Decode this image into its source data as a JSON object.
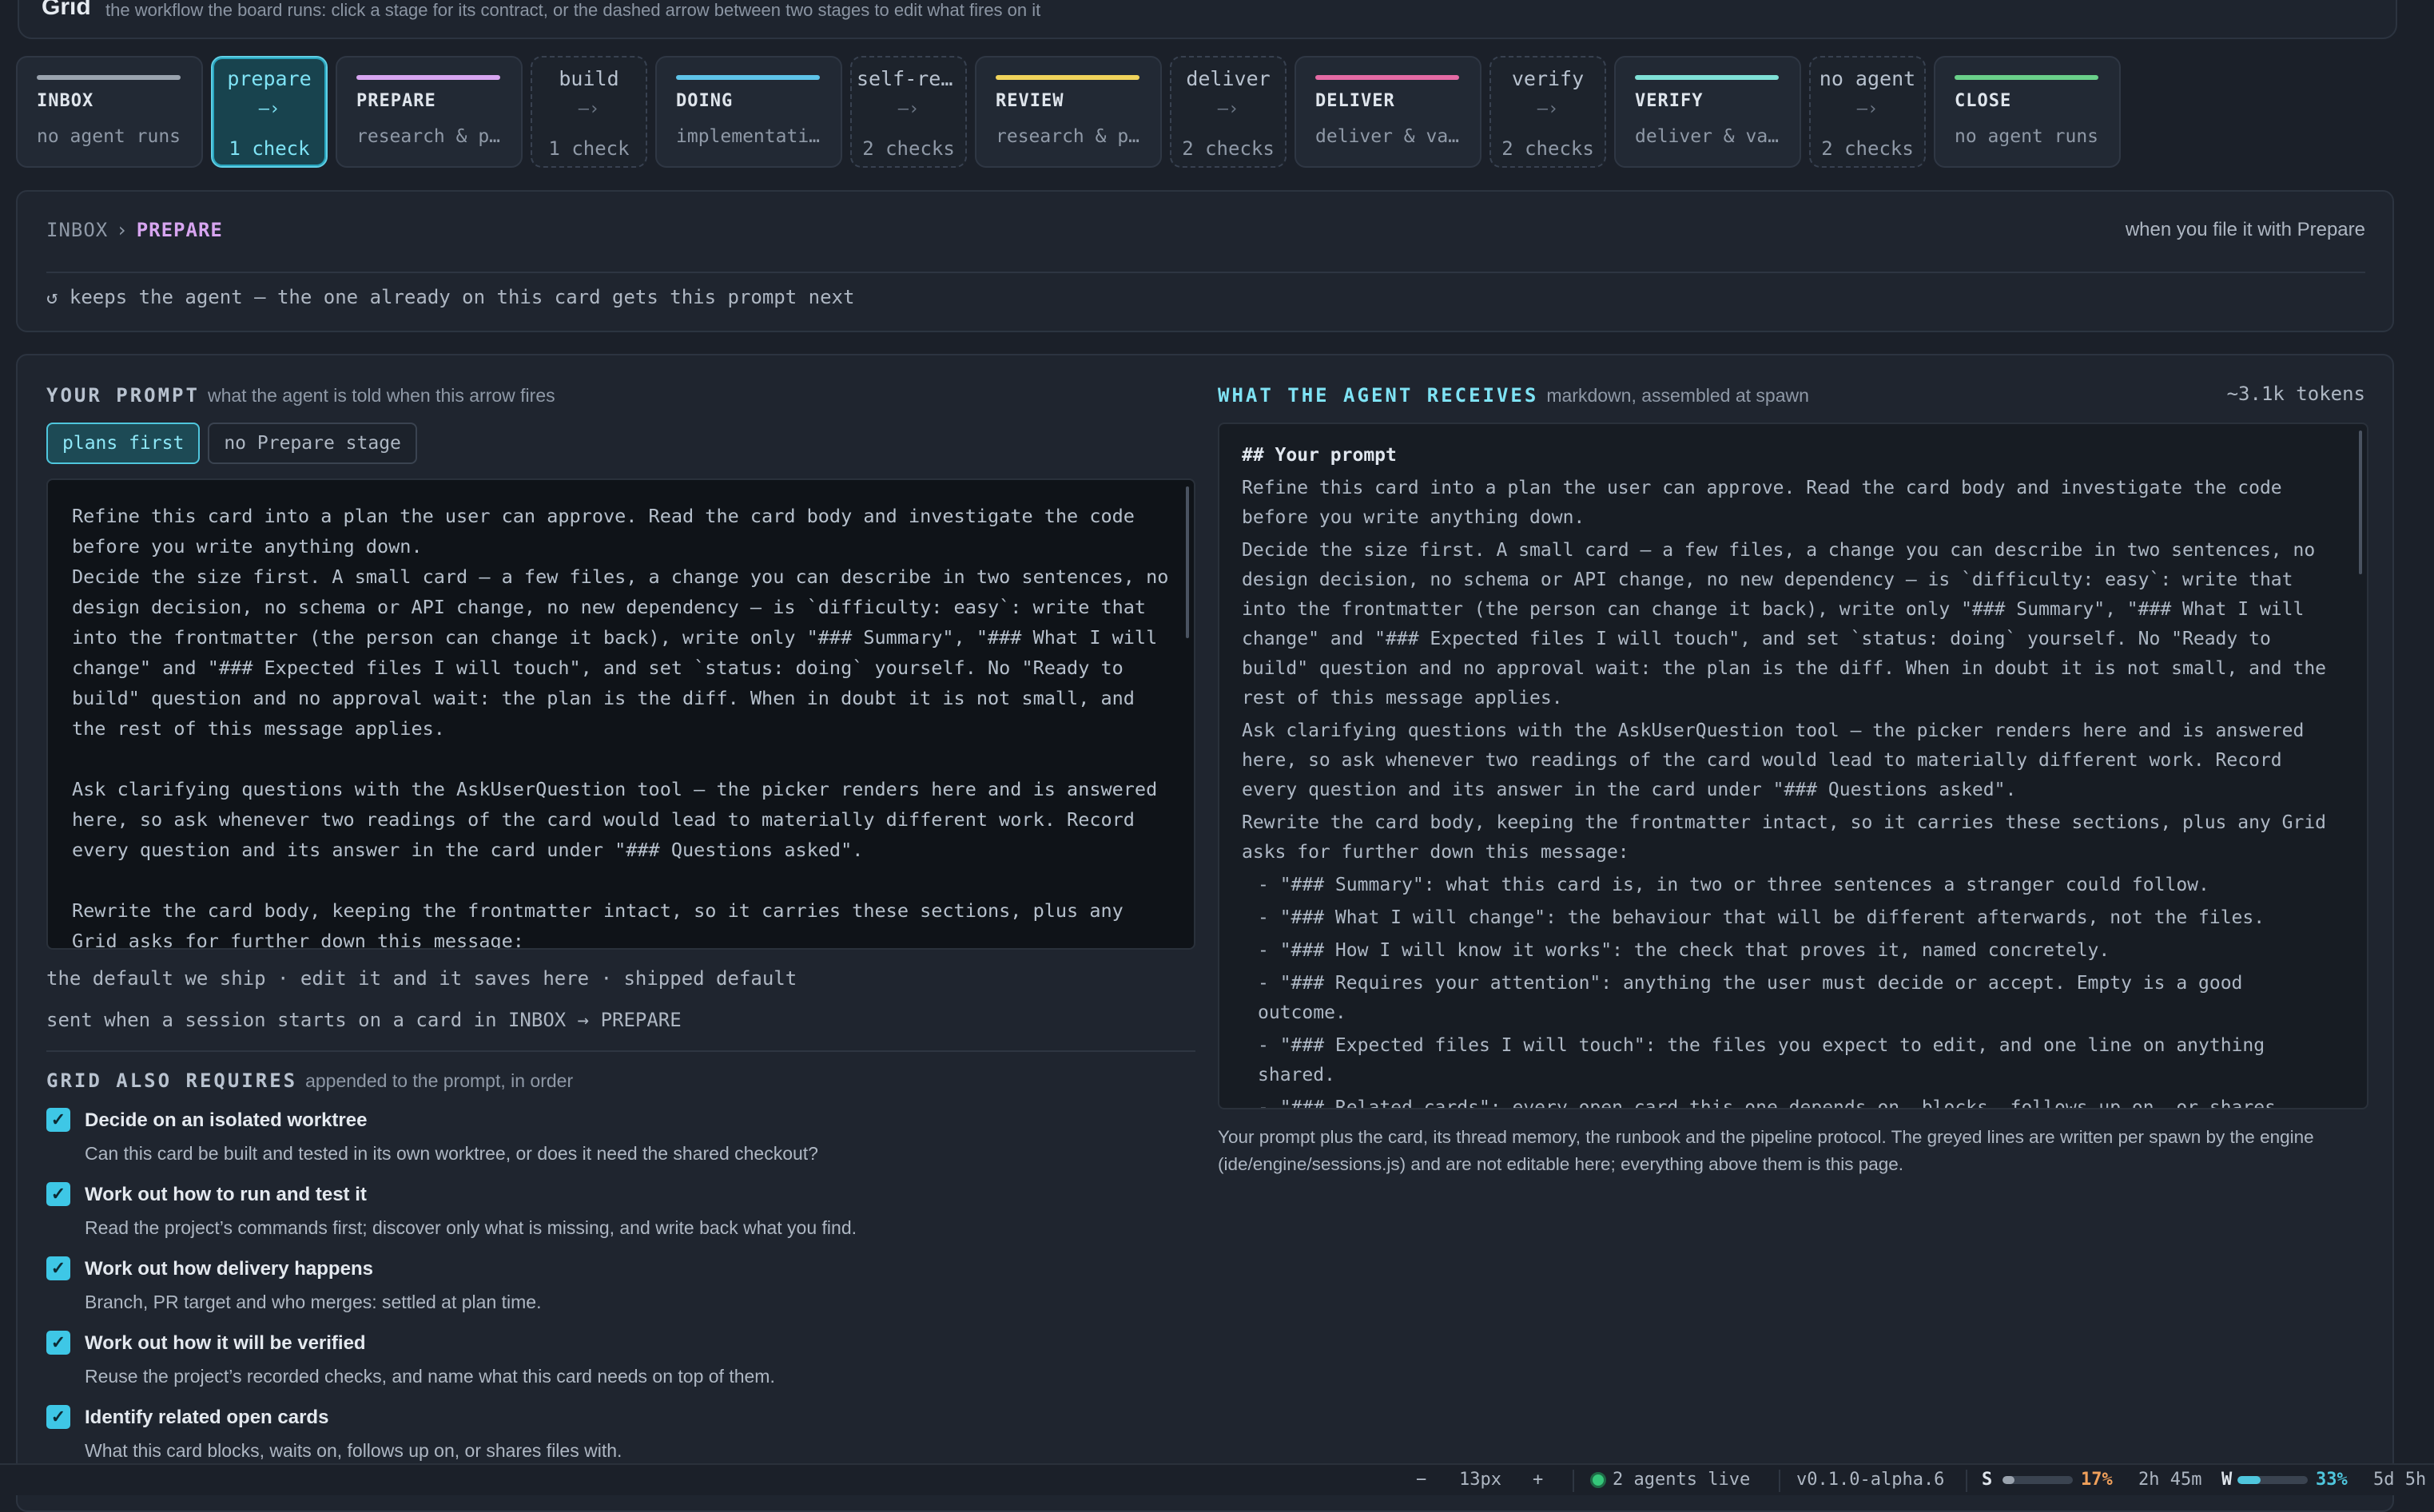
{
  "header": {
    "title": "Grid",
    "subtitle": "the workflow the board runs: click a stage for its contract, or the dashed arrow between two stages to edit what fires on it"
  },
  "pipeline": [
    {
      "kind": "stage",
      "name": "INBOX",
      "desc": "no agent runs",
      "color": "#9aa3ae"
    },
    {
      "kind": "arrow",
      "label": "prepare",
      "mid": "—›",
      "checks": "1 check",
      "selected": true
    },
    {
      "kind": "stage",
      "name": "PREPARE",
      "desc": "research & plan",
      "color": "#d7a5f0"
    },
    {
      "kind": "arrow",
      "label": "build",
      "mid": "—›",
      "checks": "1 check",
      "selected": false
    },
    {
      "kind": "stage",
      "name": "DOING",
      "desc": "implementation",
      "color": "#5ec3e8"
    },
    {
      "kind": "arrow",
      "label": "self-review",
      "mid": "—›",
      "checks": "2 checks",
      "selected": false
    },
    {
      "kind": "stage",
      "name": "REVIEW",
      "desc": "research & plan",
      "color": "#f0d35b"
    },
    {
      "kind": "arrow",
      "label": "deliver",
      "mid": "—›",
      "checks": "2 checks",
      "selected": false
    },
    {
      "kind": "stage",
      "name": "DELIVER",
      "desc": "deliver & validate",
      "color": "#e46aa4"
    },
    {
      "kind": "arrow",
      "label": "verify",
      "mid": "—›",
      "checks": "2 checks",
      "selected": false
    },
    {
      "kind": "stage",
      "name": "VERIFY",
      "desc": "deliver & validate",
      "color": "#7fe0d6"
    },
    {
      "kind": "arrow",
      "label": "no agent",
      "mid": "—›",
      "checks": "2 checks",
      "selected": false
    },
    {
      "kind": "stage",
      "name": "CLOSE",
      "desc": "no agent runs",
      "color": "#6ad08a"
    }
  ],
  "transition": {
    "from": "INBOX",
    "separator": "›",
    "to": "PREPARE",
    "when": "when you file it with Prepare",
    "keeps": "↺ keeps the agent — the one already on this card gets this prompt next"
  },
  "prompt": {
    "heading": "YOUR PROMPT",
    "hint": "what the agent is told when this arrow fires",
    "variants": [
      "plans first",
      "no Prepare stage"
    ],
    "text": "Refine this card into a plan the user can approve. Read the card body and investigate the code before you write anything down.\nDecide the size first. A small card — a few files, a change you can describe in two sentences, no design decision, no schema or API change, no new dependency — is `difficulty: easy`: write that into the frontmatter (the person can change it back), write only \"### Summary\", \"### What I will change\" and \"### Expected files I will touch\", and set `status: doing` yourself. No \"Ready to build\" question and no approval wait: the plan is the diff. When in doubt it is not small, and the rest of this message applies.\n\nAsk clarifying questions with the AskUserQuestion tool — the picker renders here and is answered here, so ask whenever two readings of the card would lead to materially different work. Record every question and its answer in the card under \"### Questions asked\".\n\nRewrite the card body, keeping the frontmatter intact, so it carries these sections, plus any Grid asks for further down this message:",
    "meta1": "the default we ship · edit it and it saves here · shipped default",
    "meta2": "sent when a session starts on a card in INBOX → PREPARE"
  },
  "requires": {
    "heading": "GRID ALSO REQUIRES",
    "hint": "appended to the prompt, in order",
    "items": [
      {
        "title": "Decide on an isolated worktree",
        "desc": "Can this card be built and tested in its own worktree, or does it need the shared checkout?",
        "checked": true
      },
      {
        "title": "Work out how to run and test it",
        "desc": "Read the project’s commands first; discover only what is missing, and write back what you find.",
        "checked": true
      },
      {
        "title": "Work out how delivery happens",
        "desc": "Branch, PR target and who merges: settled at plan time.",
        "checked": true
      },
      {
        "title": "Work out how it will be verified",
        "desc": "Reuse the project’s recorded checks, and name what this card needs on top of them.",
        "checked": true
      },
      {
        "title": "Identify related open cards",
        "desc": "What this card blocks, waits on, follows up on, or shares files with.",
        "checked": true
      }
    ]
  },
  "receives": {
    "heading": "WHAT THE AGENT RECEIVES",
    "hint": "markdown, assembled at spawn",
    "tokens": "~3.1k tokens",
    "md_heading": "## Your prompt",
    "paragraphs": [
      "Refine this card into a plan the user can approve. Read the card body and investigate the code before you write anything down.",
      "Decide the size first. A small card — a few files, a change you can describe in two sentences, no design decision, no schema or API change, no new dependency — is `difficulty: easy`: write that into the frontmatter (the person can change it back), write only \"### Summary\", \"### What I will change\" and \"### Expected files I will touch\", and set `status: doing` yourself. No \"Ready to build\" question and no approval wait: the plan is the diff. When in doubt it is not small, and the rest of this message applies.",
      "Ask clarifying questions with the AskUserQuestion tool — the picker renders here and is answered here, so ask whenever two readings of the card would lead to materially different work. Record every question and its answer in the card under \"### Questions asked\".",
      "Rewrite the card body, keeping the frontmatter intact, so it carries these sections, plus any Grid asks for further down this message:"
    ],
    "list": [
      "- \"### Summary\": what this card is, in two or three sentences a stranger could follow.",
      "- \"### What I will change\": the behaviour that will be different afterwards, not the files.",
      "- \"### How I will know it works\": the check that proves it, named concretely.",
      "- \"### Requires your attention\": anything the user must decide or accept. Empty is a good outcome.",
      "- \"### Expected files I will touch\": the files you expect to edit, and one line on anything shared.",
      "- \"### Related cards\": every open card this one depends on, blocks, follows up on, or shares files with."
    ],
    "footnote": "Your prompt plus the card, its thread memory, the runbook and the pipeline protocol. The greyed lines are written per spawn by the engine (ide/engine/sessions.js) and are not editable here; everything above them is this page."
  },
  "statusbar": {
    "zoom_minus": "−",
    "zoom": "13px",
    "zoom_plus": "+",
    "agents": "2 agents live",
    "version": "v0.1.0-alpha.6",
    "s_label": "S",
    "s_pct": "17%",
    "s_fill": 0.17,
    "s_time": "2h 45m",
    "w_label": "W",
    "w_pct": "33%",
    "w_fill": 0.33,
    "w_time": "5d 5h"
  }
}
